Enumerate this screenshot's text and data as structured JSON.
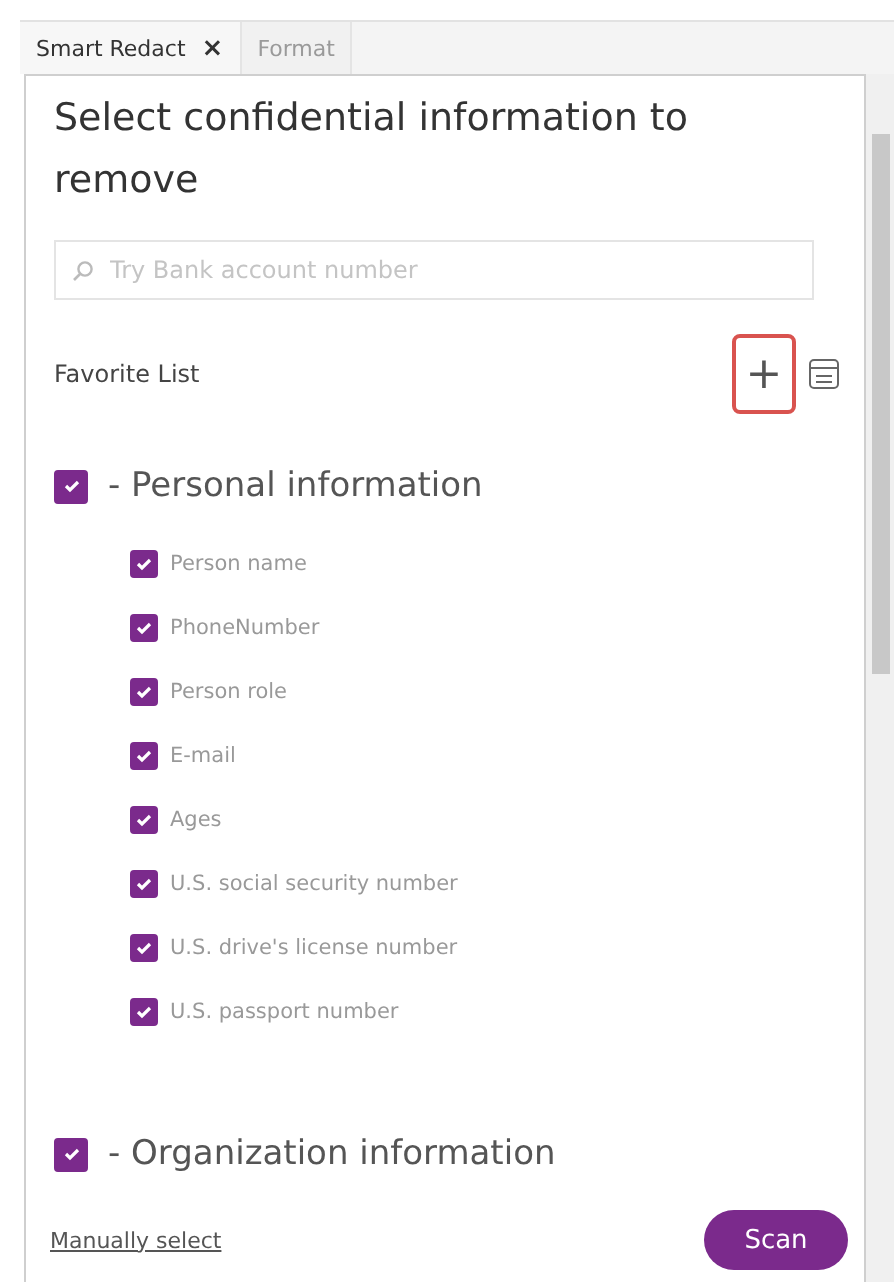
{
  "tabs": [
    {
      "label": "Smart Redact",
      "selected": true,
      "close": "×"
    },
    {
      "label": "Format",
      "selected": false
    }
  ],
  "title": "Select confidential information to remove",
  "search": {
    "placeholder": "Try Bank account number"
  },
  "favorites": {
    "label": "Favorite List",
    "add": "+"
  },
  "groups": [
    {
      "label": "- Personal information",
      "checked": true,
      "items": [
        {
          "label": "Person name",
          "checked": true
        },
        {
          "label": "PhoneNumber",
          "checked": true
        },
        {
          "label": "Person role",
          "checked": true
        },
        {
          "label": "E-mail",
          "checked": true
        },
        {
          "label": "Ages",
          "checked": true
        },
        {
          "label": "U.S. social security number",
          "checked": true
        },
        {
          "label": "U.S. drive's license number",
          "checked": true
        },
        {
          "label": "U.S. passport number",
          "checked": true
        }
      ]
    },
    {
      "label": "- Organization information",
      "checked": true
    }
  ],
  "footer": {
    "link": "Manually select",
    "button": "Scan"
  }
}
